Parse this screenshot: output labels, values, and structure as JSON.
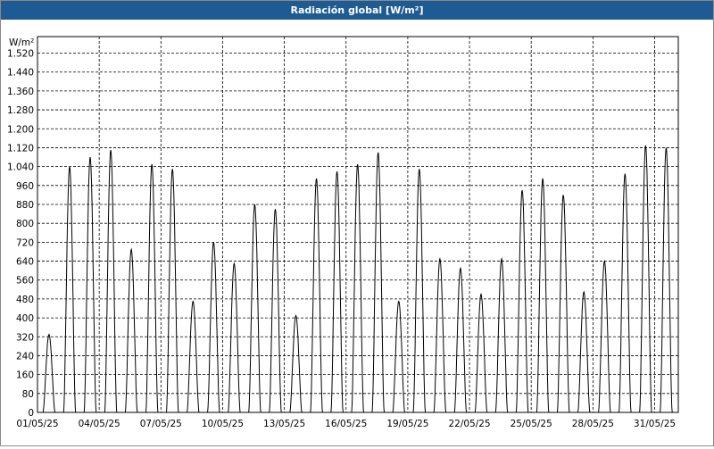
{
  "window": {
    "title": "Radiación global [W/m²]"
  },
  "chart_data": {
    "type": "line",
    "title": "Radiación global [W/m²]",
    "ylabel": "W/m²",
    "xlabel": "",
    "ylim": [
      0,
      1590
    ],
    "yticks": [
      0,
      80,
      160,
      240,
      320,
      400,
      480,
      560,
      640,
      720,
      800,
      880,
      960,
      1040,
      1120,
      1200,
      1280,
      1360,
      1440,
      1520
    ],
    "ytick_labels": [
      "0",
      "80",
      "160",
      "240",
      "320",
      "400",
      "480",
      "560",
      "640",
      "720",
      "800",
      "880",
      "960",
      "1.040",
      "1.120",
      "1.200",
      "1.280",
      "1.360",
      "1.440",
      "1.520"
    ],
    "xticks": [
      "01/05/25",
      "04/05/25",
      "07/05/25",
      "10/05/25",
      "13/05/25",
      "16/05/25",
      "19/05/25",
      "22/05/25",
      "25/05/25",
      "28/05/25",
      "31/05/25"
    ],
    "grid": true,
    "line_color": "#000000",
    "series": [
      {
        "days": [
          "01/05/25",
          "02/05/25",
          "03/05/25",
          "04/05/25",
          "05/05/25",
          "06/05/25",
          "07/05/25",
          "08/05/25",
          "09/05/25",
          "10/05/25",
          "11/05/25",
          "12/05/25",
          "13/05/25",
          "14/05/25",
          "15/05/25",
          "16/05/25",
          "17/05/25",
          "18/05/25",
          "19/05/25",
          "20/05/25",
          "21/05/25",
          "22/05/25",
          "23/05/25",
          "24/05/25",
          "25/05/25",
          "26/05/25",
          "27/05/25",
          "28/05/25",
          "29/05/25",
          "30/05/25",
          "31/05/25"
        ],
        "daily_peak": [
          330,
          1040,
          1080,
          1110,
          690,
          1050,
          1030,
          470,
          720,
          630,
          880,
          860,
          410,
          990,
          1020,
          1050,
          1100,
          470,
          1030,
          650,
          610,
          500,
          650,
          940,
          990,
          920,
          510,
          640,
          1010,
          1130,
          1120
        ]
      }
    ]
  }
}
